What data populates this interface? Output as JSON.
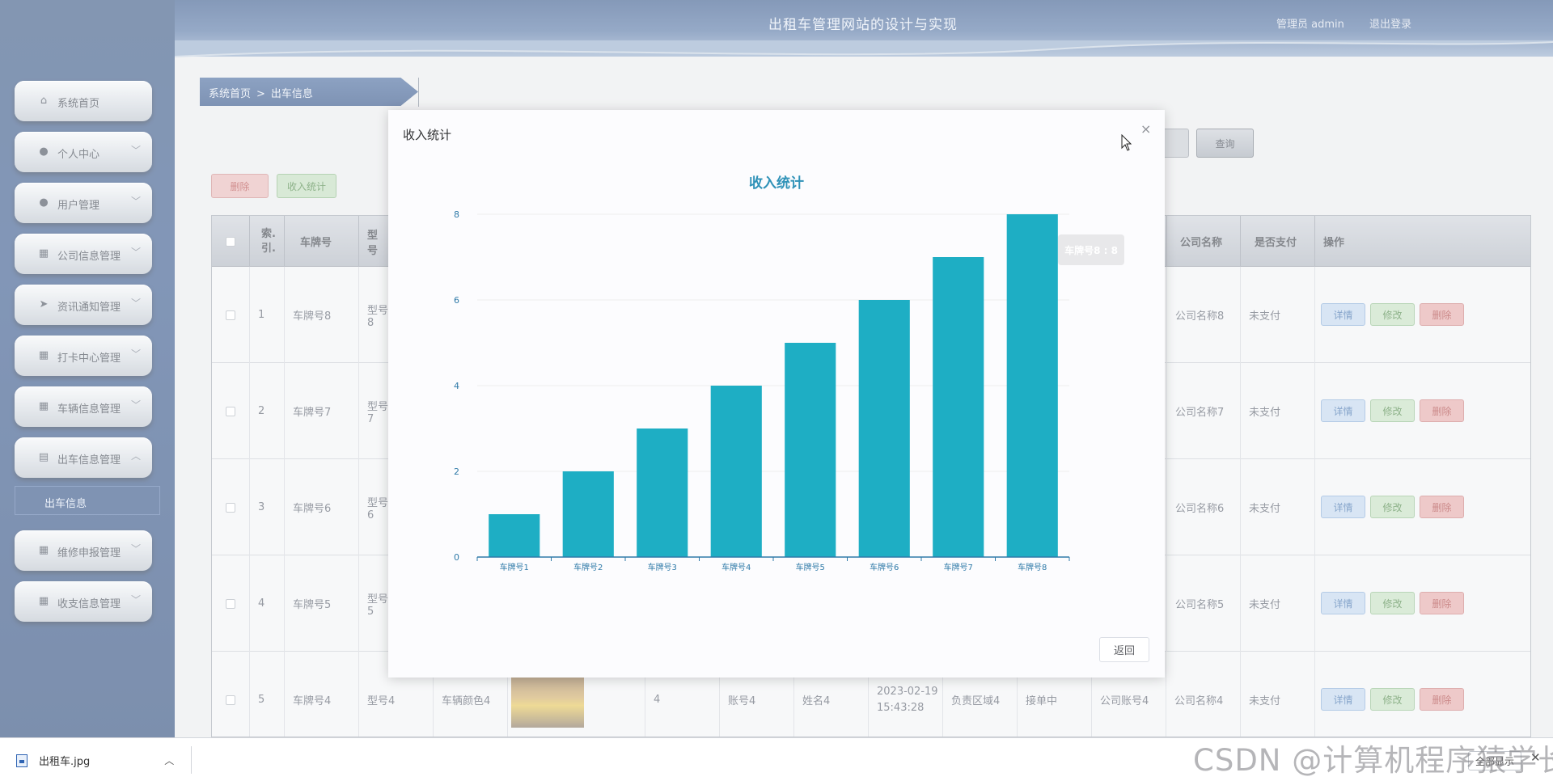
{
  "header": {
    "site_title": "出租车管理网站的设计与实现",
    "user_info": "管理员 admin",
    "logout": "退出登录"
  },
  "sidebar": {
    "items": [
      {
        "label": "系统首页",
        "icon": "home-icon",
        "expandable": false
      },
      {
        "label": "个人中心",
        "icon": "user-icon",
        "expandable": true
      },
      {
        "label": "用户管理",
        "icon": "user-icon",
        "expandable": true
      },
      {
        "label": "公司信息管理",
        "icon": "grid-icon",
        "expandable": true
      },
      {
        "label": "资讯通知管理",
        "icon": "send-icon",
        "expandable": true
      },
      {
        "label": "打卡中心管理",
        "icon": "grid-icon",
        "expandable": true
      },
      {
        "label": "车辆信息管理",
        "icon": "grid-icon",
        "expandable": true
      },
      {
        "label": "出车信息管理",
        "icon": "clipboard-icon",
        "expandable": true,
        "expanded": true
      },
      {
        "label": "维修申报管理",
        "icon": "grid-icon",
        "expandable": true
      },
      {
        "label": "收支信息管理",
        "icon": "grid-icon",
        "expandable": true
      }
    ],
    "sub_item": "出车信息"
  },
  "breadcrumb": {
    "home": "系统首页",
    "separator": ">",
    "current": "出车信息"
  },
  "toolbar": {
    "delete": "删除",
    "stats": "收入统计",
    "query": "查询"
  },
  "table": {
    "headers": [
      "",
      "索引",
      "车牌号",
      "型号",
      "公司名称",
      "是否支付",
      "操作"
    ],
    "index_header_line1": "索.",
    "index_header_line2": "引.",
    "rows": [
      {
        "index": "1",
        "plate": "车牌号8",
        "model": "型号8",
        "company": "公司名称8",
        "paid": "未支付"
      },
      {
        "index": "2",
        "plate": "车牌号7",
        "model": "型号7",
        "company": "公司名称7",
        "paid": "未支付"
      },
      {
        "index": "3",
        "plate": "车牌号6",
        "model": "型号6",
        "company": "公司名称6",
        "paid": "未支付"
      },
      {
        "index": "4",
        "plate": "车牌号5",
        "model": "型号5",
        "company": "公司名称5",
        "paid": "未支付"
      }
    ],
    "last_row": {
      "index": "5",
      "plate": "车牌号4",
      "model": "型号4",
      "color": "车辆颜色4",
      "seats": "4",
      "account": "账号4",
      "name": "姓名4",
      "date": "2023-02-19",
      "time": "15:43:28",
      "region": "负责区域4",
      "status": "接单中",
      "company_account": "公司账号4",
      "company": "公司名称4",
      "paid": "未支付"
    },
    "actions": {
      "detail": "详情",
      "edit": "修改",
      "delete": "删除"
    }
  },
  "modal": {
    "title": "收入统计",
    "close": "×",
    "return": "返回",
    "tooltip": "车牌号8 : 8"
  },
  "chart_data": {
    "type": "bar",
    "title": "收入统计",
    "categories": [
      "车牌号1",
      "车牌号2",
      "车牌号3",
      "车牌号4",
      "车牌号5",
      "车牌号6",
      "车牌号7",
      "车牌号8"
    ],
    "values": [
      1,
      2,
      3,
      4,
      5,
      6,
      7,
      8
    ],
    "ylim": [
      0,
      8
    ],
    "yticks": [
      0,
      2,
      4,
      6,
      8
    ],
    "grid": true,
    "bar_color": "#1eaec4"
  },
  "download_bar": {
    "file_name": "出租车.jpg",
    "show_all": "全部显示",
    "close": "✕"
  },
  "watermark": "CSDN @计算机程序猿学长"
}
